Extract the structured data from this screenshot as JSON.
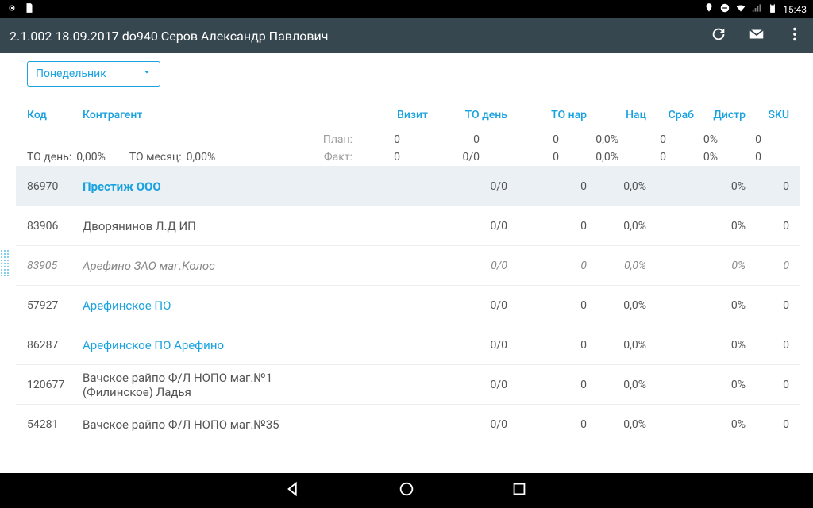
{
  "status_bar": {
    "time": "15:43"
  },
  "app_title": "2.1.002 18.09.2017 do940 Серов Александр Павлович",
  "day_selector": "Понедельник",
  "to_day_label": "ТО день:",
  "to_day_value": "0,00%",
  "to_month_label": "ТО месяц:",
  "to_month_value": "0,00%",
  "plan_label": "План:",
  "fact_label": "Факт:",
  "columns": {
    "code": "Код",
    "name": "Контрагент",
    "visit": "Визит",
    "to_day": "ТО день",
    "to_nar": "ТО нар",
    "nac": "Нац",
    "srab": "Сраб",
    "distr": "Дистр",
    "sku": "SKU"
  },
  "summary": {
    "plan": {
      "visit": "0",
      "to_day": "0",
      "to_nar": "0",
      "nac": "0,0%",
      "srab": "0",
      "distr": "0%",
      "sku": "0"
    },
    "fact": {
      "visit": "0",
      "to_day": "0/0",
      "to_nar": "0",
      "nac": "0,0%",
      "srab": "0",
      "distr": "0%",
      "sku": "0"
    }
  },
  "rows": [
    {
      "code": "86970",
      "name": "Престиж ООО",
      "to_day": "0/0",
      "to_nar": "0",
      "nac": "0,0%",
      "distr": "0%",
      "sku": "0",
      "style": "link bold sel"
    },
    {
      "code": "83906",
      "name": "Дворянинов Л.Д ИП",
      "to_day": "0/0",
      "to_nar": "0",
      "nac": "0,0%",
      "distr": "0%",
      "sku": "0",
      "style": ""
    },
    {
      "code": "83905",
      "name": "Арефино ЗАО маг.Колос",
      "to_day": "0/0",
      "to_nar": "0",
      "nac": "0,0%",
      "distr": "0%",
      "sku": "0",
      "style": "italic"
    },
    {
      "code": "57927",
      "name": "Арефинское ПО",
      "to_day": "0/0",
      "to_nar": "0",
      "nac": "0,0%",
      "distr": "0%",
      "sku": "0",
      "style": "link"
    },
    {
      "code": "86287",
      "name": "Арефинское ПО Арефино",
      "to_day": "0/0",
      "to_nar": "0",
      "nac": "0,0%",
      "distr": "0%",
      "sku": "0",
      "style": "link"
    },
    {
      "code": "120677",
      "name": "Вачское райпо Ф/Л НОПО маг.№1 (Филинское) Ладья",
      "to_day": "0/0",
      "to_nar": "0",
      "nac": "0,0%",
      "distr": "0%",
      "sku": "0",
      "style": ""
    },
    {
      "code": "54281",
      "name": "Вачское райпо Ф/Л НОПО маг.№35",
      "to_day": "0/0",
      "to_nar": "0",
      "nac": "0,0%",
      "distr": "0%",
      "sku": "0",
      "style": ""
    }
  ]
}
